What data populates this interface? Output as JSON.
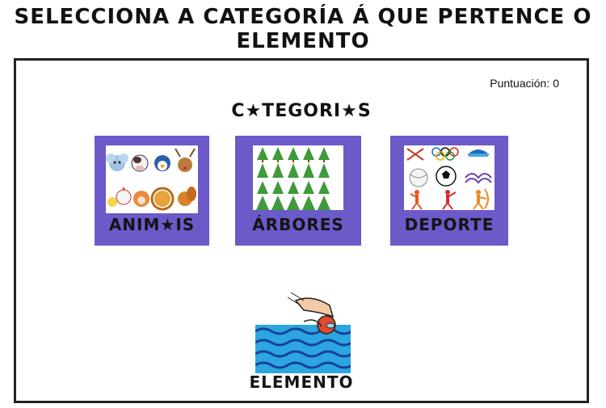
{
  "page": {
    "title": "SELECCIONA A CATEGORÍA Á QUE PERTENCE O ELEMENTO"
  },
  "score": {
    "label": "Puntuación:",
    "value": "0"
  },
  "categories_heading": "C★TEGORI★S",
  "categories": [
    {
      "label": "ANIM★IS",
      "icon": "animals-icon"
    },
    {
      "label": "ÁRBORES",
      "icon": "trees-icon"
    },
    {
      "label": "DEPORTE",
      "icon": "sports-icon"
    }
  ],
  "element": {
    "label": "ELEMENTO",
    "icon": "swimmer-icon"
  },
  "colors": {
    "card_background": "#6b5ac8",
    "frame_border": "#222222"
  }
}
